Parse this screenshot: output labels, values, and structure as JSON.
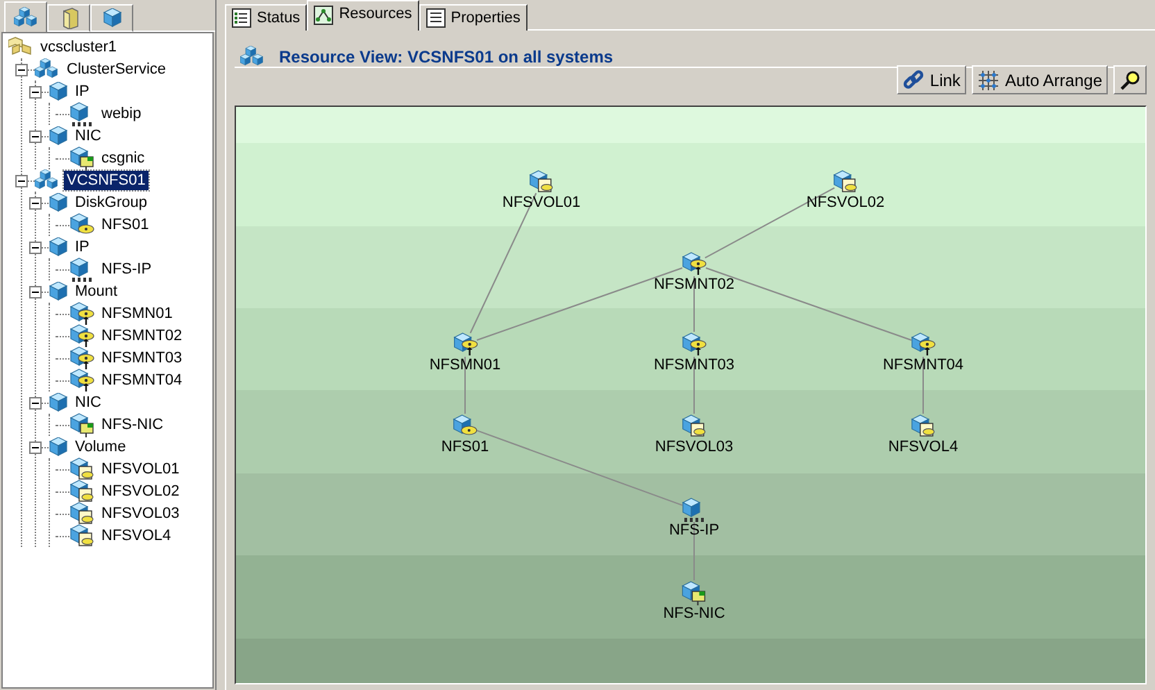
{
  "left_panel": {
    "tabs": [
      {
        "kind": "groups",
        "selected": true
      },
      {
        "kind": "systems",
        "selected": false
      },
      {
        "kind": "types",
        "selected": false
      }
    ],
    "tree": [
      {
        "label": "vcscluster1",
        "kind": "cluster",
        "selected": false,
        "children": [
          {
            "label": "ClusterService",
            "kind": "group",
            "selected": false,
            "expanded": true,
            "children": [
              {
                "label": "IP",
                "kind": "type",
                "selected": false,
                "expanded": true,
                "children": [
                  {
                    "label": "webip",
                    "kind": "ip",
                    "selected": false
                  }
                ]
              },
              {
                "label": "NIC",
                "kind": "type",
                "selected": false,
                "expanded": true,
                "children": [
                  {
                    "label": "csgnic",
                    "kind": "nic",
                    "selected": false
                  }
                ]
              }
            ]
          },
          {
            "label": "VCSNFS01",
            "kind": "group",
            "selected": true,
            "expanded": true,
            "children": [
              {
                "label": "DiskGroup",
                "kind": "type",
                "selected": false,
                "expanded": true,
                "children": [
                  {
                    "label": "NFS01",
                    "kind": "diskgroup",
                    "selected": false
                  }
                ]
              },
              {
                "label": "IP",
                "kind": "type",
                "selected": false,
                "expanded": true,
                "children": [
                  {
                    "label": "NFS-IP",
                    "kind": "ip",
                    "selected": false
                  }
                ]
              },
              {
                "label": "Mount",
                "kind": "type",
                "selected": false,
                "expanded": true,
                "children": [
                  {
                    "label": "NFSMN01",
                    "kind": "mount",
                    "selected": false
                  },
                  {
                    "label": "NFSMNT02",
                    "kind": "mount",
                    "selected": false
                  },
                  {
                    "label": "NFSMNT03",
                    "kind": "mount",
                    "selected": false
                  },
                  {
                    "label": "NFSMNT04",
                    "kind": "mount",
                    "selected": false
                  }
                ]
              },
              {
                "label": "NIC",
                "kind": "type",
                "selected": false,
                "expanded": true,
                "children": [
                  {
                    "label": "NFS-NIC",
                    "kind": "nic",
                    "selected": false
                  }
                ]
              },
              {
                "label": "Volume",
                "kind": "type",
                "selected": false,
                "expanded": true,
                "children": [
                  {
                    "label": "NFSVOL01",
                    "kind": "volume",
                    "selected": false
                  },
                  {
                    "label": "NFSVOL02",
                    "kind": "volume",
                    "selected": false
                  },
                  {
                    "label": "NFSVOL03",
                    "kind": "volume",
                    "selected": false
                  },
                  {
                    "label": "NFSVOL4",
                    "kind": "volume",
                    "selected": false
                  }
                ]
              }
            ]
          }
        ]
      }
    ]
  },
  "tabs": [
    {
      "label": "Status",
      "kind": "status",
      "selected": false
    },
    {
      "label": "Resources",
      "kind": "resources",
      "selected": true
    },
    {
      "label": "Properties",
      "kind": "properties",
      "selected": false
    }
  ],
  "view": {
    "title": "Resource View: VCSNFS01 on all systems",
    "buttons": [
      {
        "label": "Link",
        "kind": "link"
      },
      {
        "label": "Auto Arrange",
        "kind": "arrange"
      },
      {
        "kind": "zoom"
      }
    ],
    "nodes": [
      {
        "label": "NFSVOL01",
        "kind": "volume"
      },
      {
        "label": "NFSVOL02",
        "kind": "volume"
      },
      {
        "label": "NFSMNT02",
        "kind": "mount"
      },
      {
        "label": "NFSMN01",
        "kind": "mount"
      },
      {
        "label": "NFSMNT03",
        "kind": "mount"
      },
      {
        "label": "NFSMNT04",
        "kind": "mount"
      },
      {
        "label": "NFS01",
        "kind": "diskgroup"
      },
      {
        "label": "NFSVOL03",
        "kind": "volume"
      },
      {
        "label": "NFSVOL4",
        "kind": "volume"
      },
      {
        "label": "NFS-IP",
        "kind": "ip"
      },
      {
        "label": "NFS-NIC",
        "kind": "nic"
      }
    ]
  }
}
